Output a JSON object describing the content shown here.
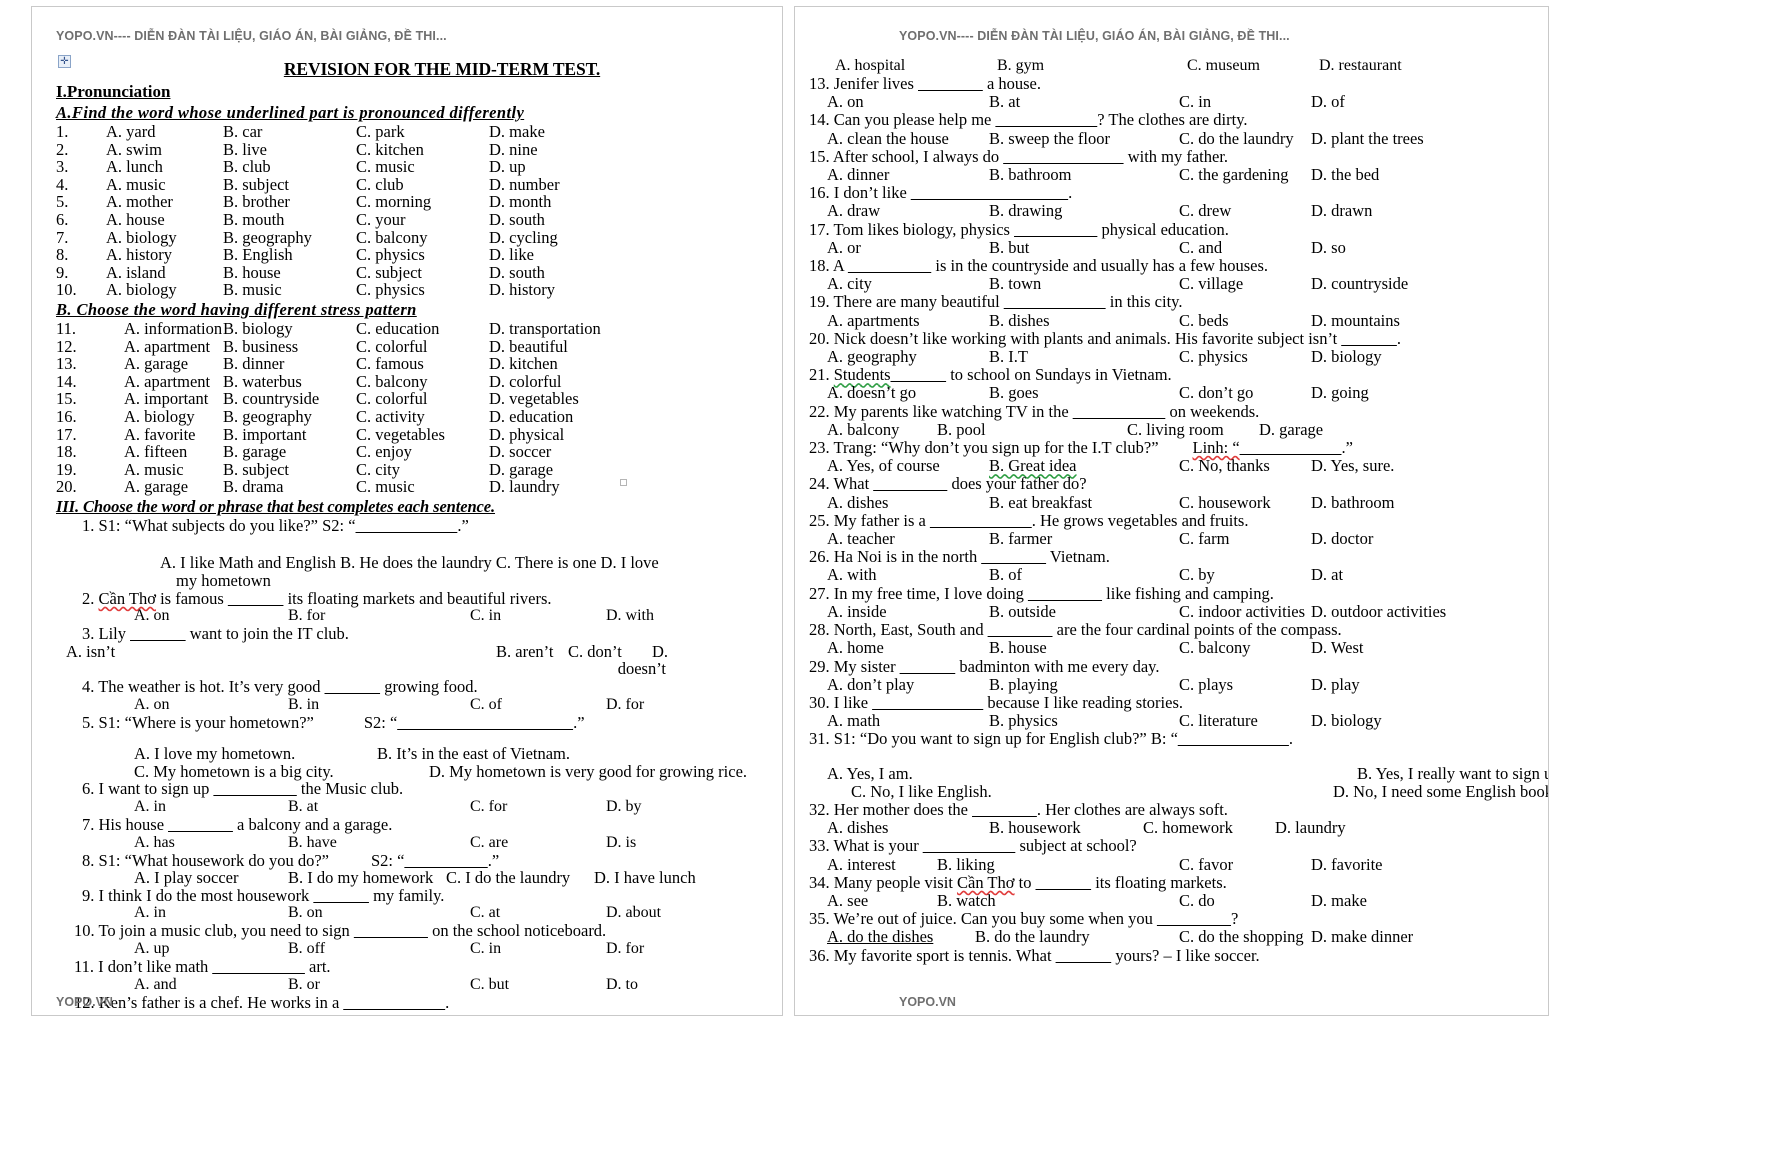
{
  "header_text": "YOPO.VN---- DIỄN ĐÀN TÀI LIỆU, GIÁO ÁN, BÀI GIẢNG, ĐỀ THI...",
  "header_text_right": "YOPO.VN---- DIỄN ĐÀN TÀI LIỆU, GIÁO ÁN, BÀI GIẢNG, ĐỀ THI...",
  "footer_text": "YOPO.VN",
  "footer_text_right": "YOPO.VN",
  "anchor_glyph": "✛",
  "doc_title": "REVISION FOR THE MID-TERM TEST.",
  "section1_title": "I.Pronunciation",
  "sectionA_title": "A.Find  the word whose  underlined  part is pronounced  differently",
  "sectionB_title": "B.  Choose  the word having  different  stress pattern",
  "section3_title": "III. Choose the word or phrase that best completes each sentence.",
  "pronunciation": [
    {
      "n": "1.",
      "a": "A. yard",
      "b": "B. car",
      "c": "C. park",
      "d": "D. make"
    },
    {
      "n": "2.",
      "a": "A. swim",
      "b": "B. live",
      "c": "C. kitchen",
      "d": "D. nine"
    },
    {
      "n": "3.",
      "a": "A. lunch",
      "b": "B. club",
      "c": "C. music",
      "d": "D. up"
    },
    {
      "n": "4.",
      "a": "A. music",
      "b": "B. subject",
      "c": "C. club",
      "d": "D. number"
    },
    {
      "n": "5.",
      "a": "A. mother",
      "b": "B. brother",
      "c": "C. morning",
      "d": "D. month"
    },
    {
      "n": "6.",
      "a": "A. house",
      "b": "B. mouth",
      "c": "C. your",
      "d": "D. south"
    },
    {
      "n": "7.",
      "a": "A. biology",
      "b": "B. geography",
      "c": "C. balcony",
      "d": "D. cycling"
    },
    {
      "n": "8.",
      "a": "A. history",
      "b": "B. English",
      "c": "C. physics",
      "d": "D. like"
    },
    {
      "n": "9.",
      "a": "A. island",
      "b": "B. house",
      "c": "C. subject",
      "d": "D. south"
    },
    {
      "n": "10.",
      "a": "A. biology",
      "b": "B. music",
      "c": "C. physics",
      "d": "D. history"
    }
  ],
  "stress": [
    {
      "n": "11.",
      "a": "A. information",
      "b": "B. biology",
      "c": "C. education",
      "d": "D. transportation"
    },
    {
      "n": "12.",
      "a": "A. apartment",
      "b": "B. business",
      "c": "C. colorful",
      "d": "D. beautiful"
    },
    {
      "n": "13.",
      "a": "A. garage",
      "b": "B. dinner",
      "c": "C. famous",
      "d": "D. kitchen"
    },
    {
      "n": "14.",
      "a": "A. apartment",
      "b": "B. waterbus",
      "c": "C. balcony",
      "d": "D. colorful"
    },
    {
      "n": "15.",
      "a": "A. important",
      "b": "B. countryside",
      "c": "C. colorful",
      "d": "D. vegetables"
    },
    {
      "n": "16.",
      "a": "A. biology",
      "b": "B. geography",
      "c": "C. activity",
      "d": "D. education"
    },
    {
      "n": "17.",
      "a": "A. favorite",
      "b": "B. important",
      "c": "C. vegetables",
      "d": "D. physical"
    },
    {
      "n": "18.",
      "a": "A. fifteen",
      "b": "B. garage",
      "c": "C. enjoy",
      "d": "D. soccer"
    },
    {
      "n": "19.",
      "a": "A. music",
      "b": "B. subject",
      "c": "C. city",
      "d": "D. garage"
    },
    {
      "n": "20.",
      "a": "A. garage",
      "b": "B. drama",
      "c": "C. music",
      "d": "D. laundry"
    }
  ],
  "q1": {
    "num": "1.",
    "stem_pre": "S1: “What subjects do you like?” S2: “",
    "blank": "___________",
    "stem_post": ".”",
    "opts_line1": "A. I like Math and English B. He does the laundry C. There is one D. I love",
    "opts_line2": "my hometown"
  },
  "q2": {
    "num": "2.",
    "stem_name": "Cần Thơ",
    "stem_mid": " is famous ",
    "blank": "______",
    "stem_post": " its floating markets and beautiful rivers.",
    "a": "A. on",
    "b": "B. for",
    "c": "C. in",
    "d": "D. with"
  },
  "q3": {
    "num": "3.",
    "stem_pre": "Lily ",
    "blank": "______",
    "stem_post": " want to join the IT club.",
    "a": "A. isn’t",
    "b": "B. aren’t",
    "c": "C. don’t",
    "d": "D.",
    "d2": "doesn’t"
  },
  "q4": {
    "num": "4.",
    "stem_pre": "The weather is hot. It’s very good ",
    "blank": "______",
    "stem_post": " growing food.",
    "a": "A. on",
    "b": "B. in",
    "c": "C. of",
    "d": "D. for"
  },
  "q5": {
    "num": "5.",
    "stem_pre": "S1: “Where is your hometown?”",
    "stem_mid": "S2: “",
    "blank": "___________________",
    "stem_post": ".”",
    "a": "A. I love my hometown.",
    "b": "B. It’s in the east of Vietnam.",
    "c": "C. My hometown is a big city.",
    "d": "D. My hometown is very good for growing rice."
  },
  "q6": {
    "num": "6.",
    "stem_pre": "I want to sign up ",
    "blank": "_________",
    "stem_post": " the Music club.",
    "a": "A. in",
    "b": "B. at",
    "c": "C. for",
    "d": "D. by"
  },
  "q7": {
    "num": "7.",
    "stem_pre": "His house ",
    "blank": "_______",
    "stem_post": " a balcony and a garage.",
    "a": "A. has",
    "b": "B. have",
    "c": "C. are",
    "d": "D. is"
  },
  "q8": {
    "num": "8.",
    "stem_pre": "S1: “What housework do you do?”",
    "stem_mid": "S2: “",
    "blank": "_________",
    "stem_post": ".”",
    "a": "A. I play soccer",
    "b": "B. I do my homework",
    "c": "C. I do the laundry",
    "d": "D. I have lunch"
  },
  "q9": {
    "num": "9.",
    "stem_pre": "I think I do the most housework ",
    "blank": "______",
    "stem_post": " my family.",
    "a": "A. in",
    "b": "B. on",
    "c": "C. at",
    "d": "D. about"
  },
  "q10": {
    "num": "10.",
    "stem_pre": "To join a music club, you need to sign ",
    "blank": "________",
    "stem_post": " on the school noticeboard.",
    "a": "A. up",
    "b": "B. off",
    "c": "C. in",
    "d": "D. for"
  },
  "q11": {
    "num": "11.",
    "stem_pre": "I don’t like math ",
    "blank": "__________",
    "stem_post": " art.",
    "a": "A. and",
    "b": "B. or",
    "c": "C. but",
    "d": "D. to"
  },
  "q12": {
    "num": "12.",
    "stem_pre": "Ken’s father is a chef. He works in a ",
    "blank": "___________",
    "stem_post": "."
  },
  "q12_opts": {
    "a": "A. hospital",
    "b": "B. gym",
    "c": "C. museum",
    "d": "D. restaurant"
  },
  "right_questions": [
    {
      "num": "13.",
      "pre": "Jenifer lives ",
      "blank": "_______",
      "post": " a house.",
      "a": "A. on",
      "b": "B. at",
      "c": "C. in",
      "d": "D. of"
    },
    {
      "num": "14.",
      "pre": "Can you please help me ",
      "blank": "___________",
      "post": "? The clothes are dirty.",
      "a": "A. clean the house",
      "b": "B. sweep the floor",
      "c": "C. do the laundry",
      "d": "D. plant the trees"
    },
    {
      "num": "15.",
      "pre": "After school, I always do ",
      "blank": "_____________",
      "post": " with my father.",
      "a": "A. dinner",
      "b": "B. bathroom",
      "c": "C. the gardening",
      "d": "D. the bed"
    },
    {
      "num": "16.",
      "pre": "I don’t like ",
      "blank": "_________________",
      "post": ".",
      "a": "A. draw",
      "b": "B. drawing",
      "c": "C. drew",
      "d": "D. drawn"
    },
    {
      "num": "17.",
      "pre": "Tom likes biology, physics ",
      "blank": "_________",
      "post": " physical education.",
      "a": "A. or",
      "b": "B. but",
      "c": "C. and",
      "d": "D. so"
    },
    {
      "num": "18.",
      "pre": "A ",
      "blank": "_________",
      "post": " is in the countryside and usually has a few houses.",
      "a": "A. city",
      "b": "B. town",
      "c": "C. village",
      "d": "D. countryside"
    },
    {
      "num": "19.",
      "pre": "There are many beautiful ",
      "blank": "___________",
      "post": " in this city.",
      "a": "A. apartments",
      "b": "B. dishes",
      "c": "C. beds",
      "d": "D. mountains"
    },
    {
      "num": "20.",
      "pre": "Nick doesn’t like working with plants and animals. His favorite subject isn’t ",
      "blank": "______",
      "post": ".",
      "a": "A. geography",
      "b": "B. I.T",
      "c": "C. physics",
      "d": "D. biology"
    },
    {
      "num": "21.",
      "pre": "Students",
      "blank": "______",
      "post": " to school on Sundays in Vietnam.",
      "a": "A. doesn’t go",
      "b": "B. goes",
      "c": "C. don’t go",
      "d": "D. going",
      "pre_spell": "green"
    },
    {
      "num": "22.",
      "pre": "My parents like watching TV in the ",
      "blank": "__________",
      "post": " on weekends.",
      "a": "A. balcony",
      "b": "B. pool",
      "c": "C. living room",
      "d": "D. garage",
      "narrow": true
    },
    {
      "num": "23.",
      "pre": "Trang: “Why don’t you sign up for the I.T club?”",
      "blank": "",
      "post": "",
      "a": "A. Yes, of course",
      "b": "B. Great idea",
      "c": "C. No, thanks",
      "d": "D. Yes, sure.",
      "special": "dialog23",
      "speaker2": "Linh: “",
      "blank2": "___________",
      "tail2": ".”"
    },
    {
      "num": "24.",
      "pre": "What ",
      "blank": "________",
      "post": " does your father do?",
      "a": "A. dishes",
      "b": "B. eat breakfast",
      "c": "C. housework",
      "d": "D. bathroom",
      "cd_tight": true
    },
    {
      "num": "25.",
      "pre": "My father is a ",
      "blank": "___________",
      "post": ". He grows vegetables and fruits.",
      "a": "A. teacher",
      "b": "B. farmer",
      "c": "C. farm",
      "d": "D. doctor"
    },
    {
      "num": "26.",
      "pre": "Ha Noi is in the north ",
      "blank": "_______",
      "post": " Vietnam.",
      "a": "A. with",
      "b": "B. of",
      "c": "C. by",
      "d": "D. at"
    },
    {
      "num": "27.",
      "pre": "In my free time, I love doing ",
      "blank": "________",
      "post": " like fishing and camping.",
      "a": "A. inside",
      "b": "B. outside",
      "c": "C. indoor activities",
      "d": "D. outdoor activities"
    },
    {
      "num": "28.",
      "pre": "North, East, South and ",
      "blank": "_______",
      "post": " are the four cardinal points of the compass.",
      "a": "A. home",
      "b": "B. house",
      "c": "C. balcony",
      "d": "D. West"
    },
    {
      "num": "29.",
      "pre": "My sister ",
      "blank": "______",
      "post": " badminton with me every day.",
      "a": "A. don’t play",
      "b": "B. playing",
      "c": "C. plays",
      "d": "D. play"
    },
    {
      "num": "30.",
      "pre": "I like ",
      "blank": "____________",
      "post": " because I like reading stories.",
      "a": "A. math",
      "b": "B. physics",
      "c": "C. literature",
      "d": "D. biology"
    }
  ],
  "q31": {
    "num": "31.",
    "stem": "S1: “Do you want to sign up for English club?” B: “",
    "blank": "____________",
    "tail": ".",
    "a": "A. Yes, I am.",
    "b": "B. Yes, I really want to sign up for it.",
    "c": "C. No, I like English.",
    "d": "D. No, I need some English books."
  },
  "q32": {
    "num": "32.",
    "pre": "Her mother does the ",
    "blank": "_______",
    "post": ". Her clothes are always soft.",
    "a": "A. dishes",
    "b": "B. housework",
    "c": "C. homework",
    "d": "D. laundry"
  },
  "q33": {
    "num": "33.",
    "pre": "What is your ",
    "blank": "__________",
    "post": " subject at school?",
    "a": "A. interest",
    "b": "B. liking",
    "c": "C. favor",
    "d": "D. favorite"
  },
  "q34": {
    "num": "34.",
    "pre": "Many people visit ",
    "name": "Cần Thơ",
    "mid": " to ",
    "blank": "______",
    "post": " its floating markets.",
    "a": "A. see",
    "b": "B. watch",
    "c": "C. do",
    "d": "D. make"
  },
  "q35": {
    "num": "35.",
    "stem": "We’re out of juice. Can you buy some when you ",
    "blank": "________",
    "post": "?",
    "a": "A. do the dishes",
    "b": "B. do the laundry",
    "c": "C. do the shopping",
    "d": "D. make dinner"
  },
  "q36": {
    "num": "36.",
    "stem": "My favorite sport is tennis. What ",
    "blank": "______",
    "post": " yours? – I like soccer."
  }
}
